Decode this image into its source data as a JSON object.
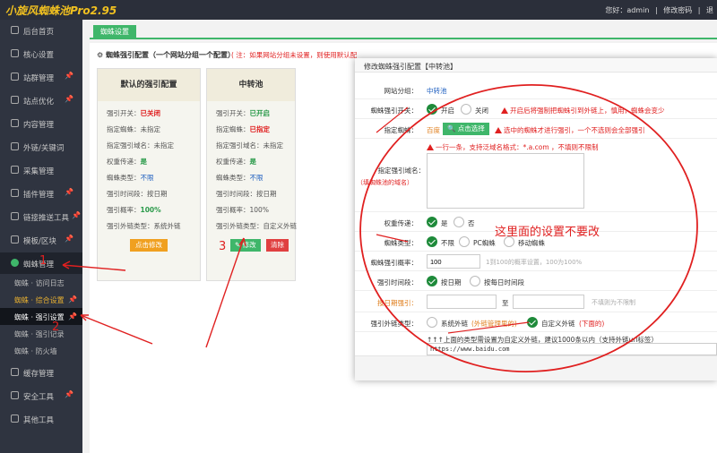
{
  "app": {
    "title": "小旋风蜘蛛池Pro2.95"
  },
  "header": {
    "greeting": "您好：admin",
    "sep": "|",
    "change_password": "修改密码",
    "logout": "退"
  },
  "sidebar": {
    "items": [
      {
        "label": "后台首页",
        "pin": ""
      },
      {
        "label": "核心设置",
        "pin": ""
      },
      {
        "label": "站群管理",
        "pin": "📌"
      },
      {
        "label": "站点优化",
        "pin": "📌"
      },
      {
        "label": "内容管理",
        "pin": ""
      },
      {
        "label": "外链/关键词",
        "pin": ""
      },
      {
        "label": "采集管理",
        "pin": ""
      },
      {
        "label": "插件管理",
        "pin": "📌"
      },
      {
        "label": "链接推送工具",
        "pin": "📌"
      },
      {
        "label": "模板/区块",
        "pin": "📌"
      },
      {
        "label": "蜘蛛管理",
        "pin": ""
      }
    ],
    "subitems": [
      {
        "label": "蜘蛛 · 访问日志",
        "pin": ""
      },
      {
        "label": "蜘蛛 · 综合设置",
        "pin": "📌"
      },
      {
        "label": "蜘蛛 · 强引设置",
        "pin": "📌"
      },
      {
        "label": "蜘蛛 · 强引记录",
        "pin": ""
      },
      {
        "label": "蜘蛛 · 防火墙",
        "pin": ""
      }
    ],
    "bottom_items": [
      {
        "label": "缓存管理"
      },
      {
        "label": "安全工具",
        "pin": "📌"
      },
      {
        "label": "其他工具"
      }
    ]
  },
  "tabs": [
    {
      "label": "蜘蛛设置"
    }
  ],
  "config": {
    "title": "蜘蛛强引配置（一个网站分组一个配置）",
    "note": "( 注：如果网站分组未设置，则使用默认配"
  },
  "cards": [
    {
      "title": "默认的强引配置",
      "rows": [
        {
          "k": "强引开关：",
          "v": "已关闭",
          "c": "red"
        },
        {
          "k": "指定蜘蛛：",
          "v": "未指定",
          "c": "plain"
        },
        {
          "k": "指定强引域名：",
          "v": "未指定",
          "c": "plain"
        },
        {
          "k": "权重传递：",
          "v": "是",
          "c": "green"
        },
        {
          "k": "蜘蛛类型：",
          "v": "不限",
          "c": "blue"
        },
        {
          "k": "强引时间段：",
          "v": "按日期",
          "c": "plain"
        },
        {
          "k": "强引概率：",
          "v": "100%",
          "c": "green"
        },
        {
          "k": "强引外链类型：",
          "v": "系统外链",
          "c": "plain"
        }
      ],
      "btn_edit": "点击修改"
    },
    {
      "title": "中转池",
      "rows": [
        {
          "k": "强引开关：",
          "v": "已开启",
          "c": "green"
        },
        {
          "k": "指定蜘蛛：",
          "v": "已指定",
          "c": "red"
        },
        {
          "k": "指定强引域名：",
          "v": "未指定",
          "c": "plain"
        },
        {
          "k": "权重传递：",
          "v": "是",
          "c": "green"
        },
        {
          "k": "蜘蛛类型：",
          "v": "不限",
          "c": "blue"
        },
        {
          "k": "强引时间段：",
          "v": "按日期",
          "c": "plain"
        },
        {
          "k": "强引概率：",
          "v": "100%",
          "c": "plain"
        },
        {
          "k": "强引外链类型：",
          "v": "自定义外链",
          "c": "plain"
        }
      ],
      "btn_edit": "修改",
      "btn_delete": "清除"
    }
  ],
  "modal": {
    "title": "修改蜘蛛强引配置【中转池】",
    "group_label": "网站分组：",
    "group_value": "中转池",
    "switch_label": "蜘蛛强引开关：",
    "switch_on": "开启",
    "switch_off": "关闭",
    "switch_warn": "开启后将强制把蜘蛛引到外链上，慎用，蜘蛛会变少",
    "spider_label": "指定蜘蛛：",
    "spider_value": "百度",
    "spider_btn": "点击选择",
    "spider_warn": "选中的蜘蛛才进行强引，一个不选则会全部强引",
    "domain_warn": "一行一条，支持泛域名格式：*.a.com ，不填则不限制",
    "domain_label": "指定强引域名：",
    "domain_sub": "（填蜘蛛池的域名）",
    "weight_label": "权重传递：",
    "weight_yes": "是",
    "weight_no": "否",
    "type_label": "蜘蛛类型：",
    "type_opt1": "不限",
    "type_opt2": "PC蜘蛛",
    "type_opt3": "移动蜘蛛",
    "prob_label": "蜘蛛强引概率：",
    "prob_value": "100",
    "prob_hint": "1到100的概率设置，100为100%",
    "time_label": "强引时间段：",
    "time_opt1": "按日期",
    "time_opt2": "按每日时间段",
    "date_label": "按日期强引：",
    "date_to": "至",
    "date_hint": "不填则为不限制",
    "link_label": "强引外链类型：",
    "link_opt1": "系统外链",
    "link_opt1_note": "(外链管理里的)",
    "link_opt2": "自定义外链",
    "link_opt2_note": "(下面的)",
    "custom_note": "↑↑↑上面的类型需设置为自定义外链，建议1000条以内（支持外链url标签）",
    "custom_value": "https://www.baidu.com"
  },
  "annotations": {
    "note": "这里面的设置不要改",
    "n1": "1",
    "n2": "2",
    "n3": "3"
  }
}
